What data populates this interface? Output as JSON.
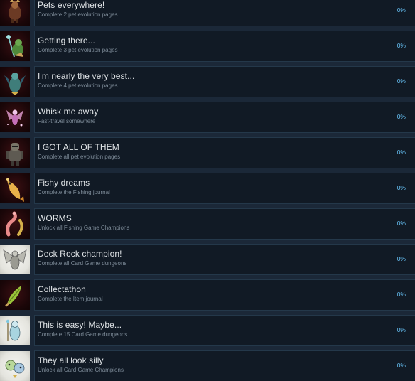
{
  "achievements": [
    {
      "title": "Pets everywhere!",
      "desc": "Complete 2 pet evolution pages",
      "percent": "0%",
      "icon": "armored-pet-icon",
      "icon_bg": "dark"
    },
    {
      "title": "Getting there...",
      "desc": "Complete 3 pet evolution pages",
      "percent": "0%",
      "icon": "green-staff-creature-icon",
      "icon_bg": "dark"
    },
    {
      "title": "I'm nearly the very best...",
      "desc": "Complete 4 pet evolution pages",
      "percent": "0%",
      "icon": "dragon-creature-icon",
      "icon_bg": "dark"
    },
    {
      "title": "Whisk me away",
      "desc": "Fast-travel somewhere",
      "percent": "0%",
      "icon": "pink-fairy-icon",
      "icon_bg": "dark"
    },
    {
      "title": "I GOT ALL OF THEM",
      "desc": "Complete all pet evolution pages",
      "percent": "0%",
      "icon": "armored-knight-icon",
      "icon_bg": "dark"
    },
    {
      "title": "Fishy dreams",
      "desc": "Complete the Fishing journal",
      "percent": "0%",
      "icon": "fish-icon",
      "icon_bg": "dark"
    },
    {
      "title": "WORMS",
      "desc": "Unlock all Fishing Game Champions",
      "percent": "0%",
      "icon": "worm-icon",
      "icon_bg": "dark"
    },
    {
      "title": "Deck Rock champion!",
      "desc": "Complete all Card Game dungeons",
      "percent": "0%",
      "icon": "winged-champion-icon",
      "icon_bg": "light"
    },
    {
      "title": "Collectathon",
      "desc": "Complete the Item journal",
      "percent": "0%",
      "icon": "leaf-sword-icon",
      "icon_bg": "dark"
    },
    {
      "title": "This is easy! Maybe...",
      "desc": "Complete 15 Card Game dungeons",
      "percent": "0%",
      "icon": "card-spirit-icon",
      "icon_bg": "light"
    },
    {
      "title": "They all look silly",
      "desc": "Unlock all Card Game Champions",
      "percent": "0%",
      "icon": "silly-champions-icon",
      "icon_bg": "light"
    }
  ]
}
